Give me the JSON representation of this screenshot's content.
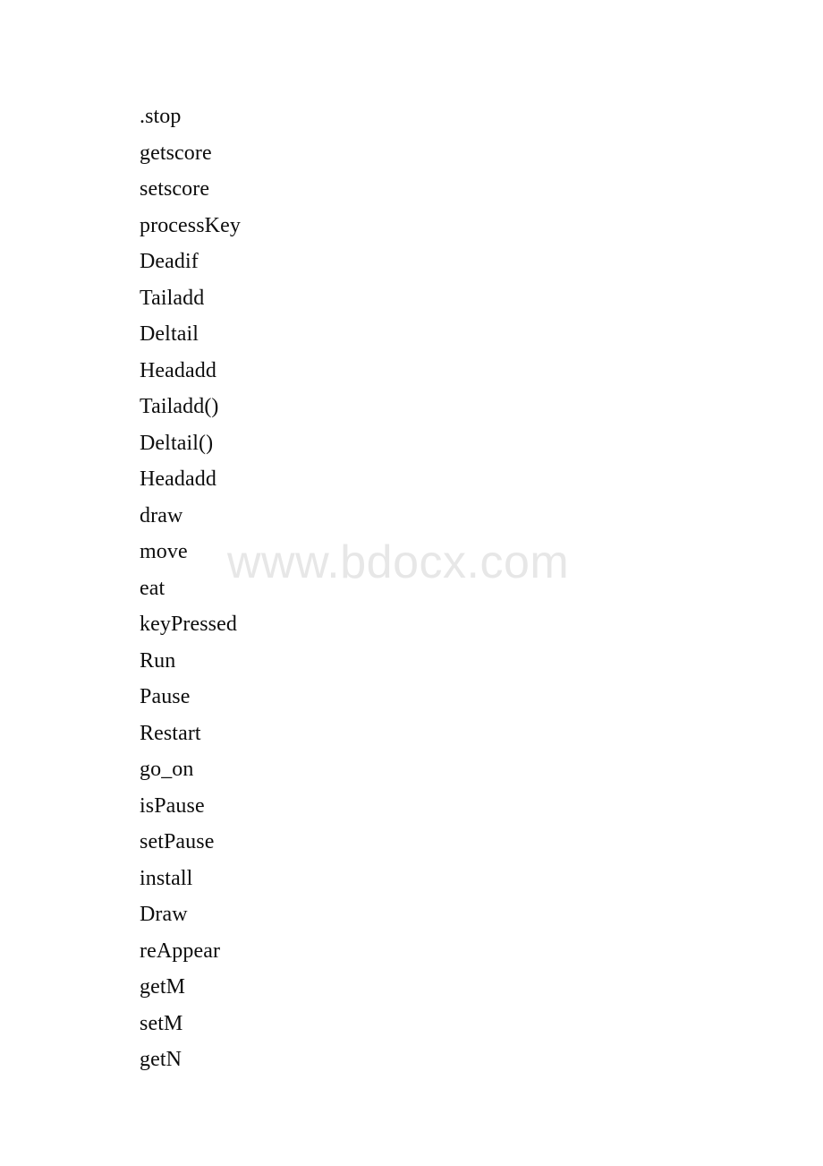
{
  "page": {
    "background_color": "#ffffff",
    "text_color": "#0d0d0d"
  },
  "watermark": {
    "text": "www.bdocx.com",
    "color": "#e7e7e7"
  },
  "document": {
    "lines": [
      {
        "text": ".stop"
      },
      {
        "text": "getscore"
      },
      {
        "text": "setscore"
      },
      {
        "text": "processKey"
      },
      {
        "text": "Deadif"
      },
      {
        "text": "Tailadd"
      },
      {
        "text": "Deltail"
      },
      {
        "text": "Headadd"
      },
      {
        "text": "Tailadd()"
      },
      {
        "text": "Deltail()"
      },
      {
        "text": "Headadd"
      },
      {
        "text": "draw"
      },
      {
        "text": "move"
      },
      {
        "text": "eat"
      },
      {
        "text": "keyPressed"
      },
      {
        "text": "Run"
      },
      {
        "text": "Pause"
      },
      {
        "text": "Restart"
      },
      {
        "text": "go_on"
      },
      {
        "text": "isPause"
      },
      {
        "text": "setPause"
      },
      {
        "text": "install"
      },
      {
        "text": "Draw"
      },
      {
        "text": "reAppear"
      },
      {
        "text": "getM"
      },
      {
        "text": "setM"
      },
      {
        "text": "getN"
      }
    ]
  }
}
